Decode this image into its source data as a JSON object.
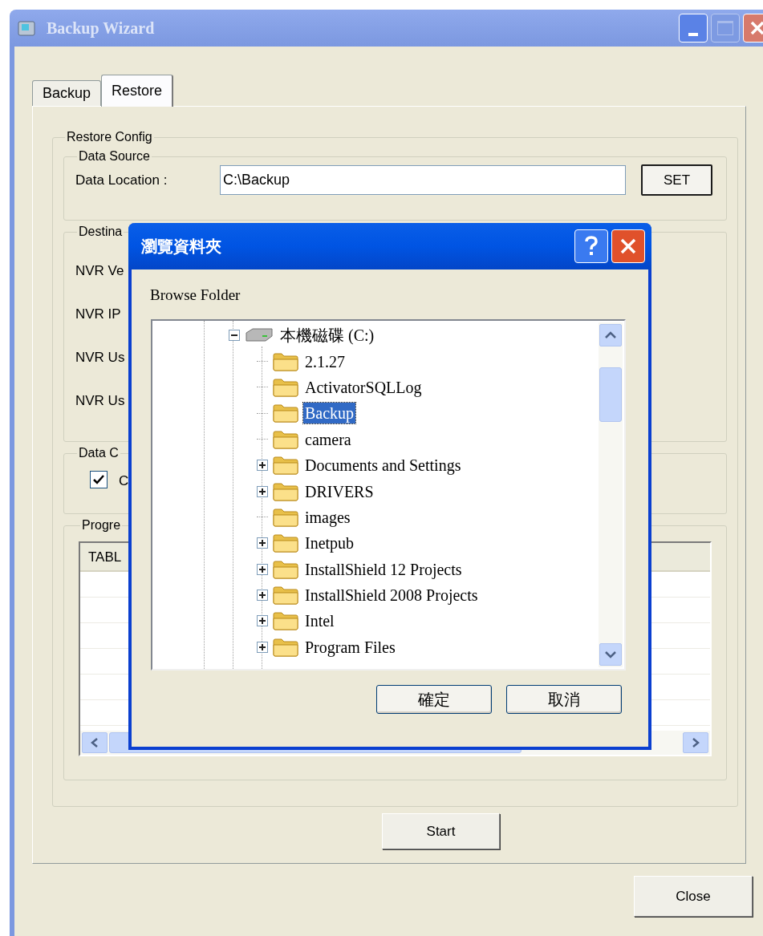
{
  "window": {
    "title": "Backup Wizard"
  },
  "tabs": [
    {
      "label": "Backup",
      "selected": false
    },
    {
      "label": "Restore",
      "selected": true
    }
  ],
  "restore_config": {
    "legend": "Restore Config",
    "data_source": {
      "legend": "Data Source",
      "label": "Data Location :",
      "value": "C:\\Backup",
      "button": "SET"
    },
    "destination": {
      "legend": "Destina",
      "labels": [
        "NVR Ve",
        "NVR IP",
        "NVR Us",
        "NVR Us"
      ]
    },
    "data_options": {
      "legend": "Data C",
      "checkbox": {
        "label": "C",
        "checked": true
      }
    },
    "progress": {
      "legend": "Progre",
      "table": {
        "columns": [
          "TABL"
        ]
      }
    }
  },
  "start_button": "Start",
  "close_button": "Close",
  "dialog": {
    "title": "瀏覽資料夾",
    "prompt": "Browse Folder",
    "tree": [
      {
        "label": "本機磁碟 (C:)",
        "kind": "drive",
        "expanded": true,
        "selected": false,
        "children": [
          {
            "label": "2.1.27",
            "kind": "folder",
            "selected": false
          },
          {
            "label": "ActivatorSQLLog",
            "kind": "folder",
            "selected": false
          },
          {
            "label": "Backup",
            "kind": "folder",
            "selected": true
          },
          {
            "label": "camera",
            "kind": "folder",
            "selected": false
          },
          {
            "label": "Documents and Settings",
            "kind": "folder",
            "expanded": false,
            "selected": false
          },
          {
            "label": "DRIVERS",
            "kind": "folder",
            "expanded": false,
            "selected": false
          },
          {
            "label": "images",
            "kind": "folder",
            "selected": false
          },
          {
            "label": "Inetpub",
            "kind": "folder",
            "expanded": false,
            "selected": false
          },
          {
            "label": "InstallShield 12 Projects",
            "kind": "folder",
            "expanded": false,
            "selected": false
          },
          {
            "label": "InstallShield 2008 Projects",
            "kind": "folder",
            "expanded": false,
            "selected": false
          },
          {
            "label": "Intel",
            "kind": "folder",
            "expanded": false,
            "selected": false
          },
          {
            "label": "Program Files",
            "kind": "folder",
            "expanded": false,
            "selected": false
          }
        ]
      }
    ],
    "buttons": [
      "確定",
      "取消"
    ]
  }
}
